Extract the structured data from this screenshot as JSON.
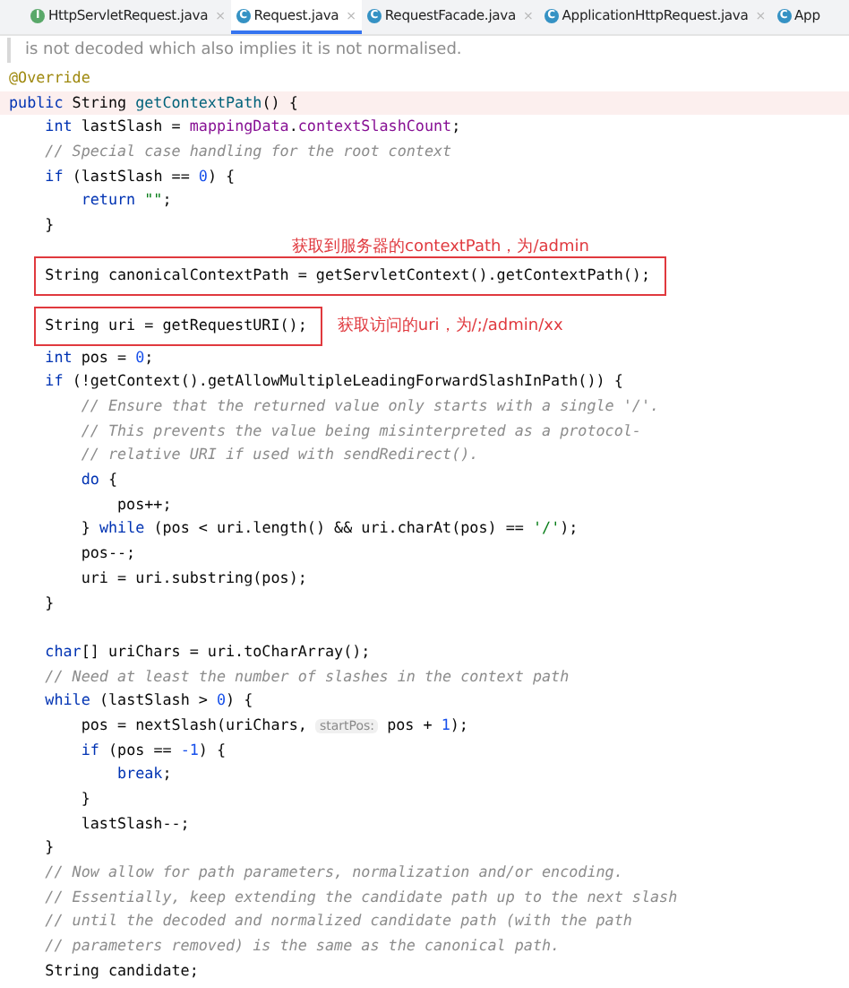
{
  "tabs": [
    {
      "badge": "I",
      "color": "#59a869",
      "label": "HttpServletRequest.java",
      "close": "×",
      "selected": false
    },
    {
      "badge": "C",
      "color": "#3592c4",
      "label": "Request.java",
      "close": "×",
      "selected": true
    },
    {
      "badge": "C",
      "color": "#3592c4",
      "label": "RequestFacade.java",
      "close": "×",
      "selected": false
    },
    {
      "badge": "C",
      "color": "#3592c4",
      "label": "ApplicationHttpRequest.java",
      "close": "×",
      "selected": false
    },
    {
      "badge": "C",
      "color": "#3592c4",
      "label": "App",
      "selected": false
    }
  ],
  "doc_comment": "is not decoded which also implies it is not normalised.",
  "code_lines": [
    {
      "kind": "code",
      "tokens": [
        {
          "kind": "annotation",
          "text": "@Override"
        }
      ]
    },
    {
      "kind": "current",
      "tokens": [
        {
          "kind": "kw",
          "text": "public "
        },
        {
          "kind": "plain",
          "text": "String "
        },
        {
          "kind": "decl",
          "text": "getContextPath"
        },
        {
          "kind": "plain",
          "text": "() {"
        }
      ]
    },
    {
      "kind": "code",
      "tokens": [
        {
          "kind": "kw",
          "text": "    int "
        },
        {
          "kind": "plain",
          "text": "lastSlash = "
        },
        {
          "kind": "field",
          "text": "mappingData"
        },
        {
          "kind": "plain",
          "text": "."
        },
        {
          "kind": "field",
          "text": "contextSlashCount"
        },
        {
          "kind": "plain",
          "text": ";"
        }
      ]
    },
    {
      "kind": "code",
      "tokens": [
        {
          "kind": "comment",
          "text": "    // Special case handling for the root context"
        }
      ]
    },
    {
      "kind": "code",
      "tokens": [
        {
          "kind": "kw",
          "text": "    if "
        },
        {
          "kind": "plain",
          "text": "(lastSlash == "
        },
        {
          "kind": "num",
          "text": "0"
        },
        {
          "kind": "plain",
          "text": ") {"
        }
      ]
    },
    {
      "kind": "code",
      "tokens": [
        {
          "kind": "kw",
          "text": "        return "
        },
        {
          "kind": "str",
          "text": "\"\""
        },
        {
          "kind": "plain",
          "text": ";"
        }
      ]
    },
    {
      "kind": "code",
      "tokens": [
        {
          "kind": "plain",
          "text": "    }"
        }
      ]
    },
    {
      "kind": "note",
      "note": "获取到服务器的contextPath，为/admin"
    },
    {
      "kind": "boxed",
      "tokens": [
        {
          "kind": "plain",
          "text": "    String canonicalContextPath = getServletContext().getContextPath();"
        }
      ]
    },
    {
      "kind": "boxed",
      "note": "获取访问的uri，为/;/admin/xx",
      "tokens": [
        {
          "kind": "plain",
          "text": "    String uri = getRequestURI();"
        }
      ]
    },
    {
      "kind": "code",
      "tokens": [
        {
          "kind": "kw",
          "text": "    int "
        },
        {
          "kind": "plain",
          "text": "pos = "
        },
        {
          "kind": "num",
          "text": "0"
        },
        {
          "kind": "plain",
          "text": ";"
        }
      ]
    },
    {
      "kind": "code",
      "tokens": [
        {
          "kind": "kw",
          "text": "    if "
        },
        {
          "kind": "plain",
          "text": "(!getContext().getAllowMultipleLeadingForwardSlashInPath()) {"
        }
      ]
    },
    {
      "kind": "code",
      "tokens": [
        {
          "kind": "comment",
          "text": "        // Ensure that the returned value only starts with a single '/'."
        }
      ]
    },
    {
      "kind": "code",
      "tokens": [
        {
          "kind": "comment",
          "text": "        // This prevents the value being misinterpreted as a protocol-"
        }
      ]
    },
    {
      "kind": "code",
      "tokens": [
        {
          "kind": "comment",
          "text": "        // relative URI if used with sendRedirect()."
        }
      ]
    },
    {
      "kind": "code",
      "tokens": [
        {
          "kind": "kw",
          "text": "        do "
        },
        {
          "kind": "plain",
          "text": "{"
        }
      ]
    },
    {
      "kind": "code",
      "tokens": [
        {
          "kind": "plain",
          "text": "            pos++;"
        }
      ]
    },
    {
      "kind": "code",
      "tokens": [
        {
          "kind": "plain",
          "text": "        } "
        },
        {
          "kind": "kw",
          "text": "while "
        },
        {
          "kind": "plain",
          "text": "(pos < uri.length() && uri.charAt(pos) == "
        },
        {
          "kind": "str",
          "text": "'/'"
        },
        {
          "kind": "plain",
          "text": ");"
        }
      ]
    },
    {
      "kind": "code",
      "tokens": [
        {
          "kind": "plain",
          "text": "        pos--;"
        }
      ]
    },
    {
      "kind": "code",
      "tokens": [
        {
          "kind": "plain",
          "text": "        uri = uri.substring(pos);"
        }
      ]
    },
    {
      "kind": "code",
      "tokens": [
        {
          "kind": "plain",
          "text": "    }"
        }
      ]
    },
    {
      "kind": "blank"
    },
    {
      "kind": "code",
      "tokens": [
        {
          "kind": "kw",
          "text": "    char"
        },
        {
          "kind": "plain",
          "text": "[] uriChars = uri.toCharArray();"
        }
      ]
    },
    {
      "kind": "code",
      "tokens": [
        {
          "kind": "comment",
          "text": "    // Need at least the number of slashes in the context path"
        }
      ]
    },
    {
      "kind": "code",
      "tokens": [
        {
          "kind": "kw",
          "text": "    while "
        },
        {
          "kind": "plain",
          "text": "(lastSlash > "
        },
        {
          "kind": "num",
          "text": "0"
        },
        {
          "kind": "plain",
          "text": ") {"
        }
      ]
    },
    {
      "kind": "code",
      "tokens": [
        {
          "kind": "plain",
          "text": "        pos = nextSlash(uriChars, "
        },
        {
          "kind": "hint",
          "text": "startPos:"
        },
        {
          "kind": "plain",
          "text": " pos + "
        },
        {
          "kind": "num",
          "text": "1"
        },
        {
          "kind": "plain",
          "text": ");"
        }
      ]
    },
    {
      "kind": "code",
      "tokens": [
        {
          "kind": "kw",
          "text": "        if "
        },
        {
          "kind": "plain",
          "text": "(pos == "
        },
        {
          "kind": "num",
          "text": "-1"
        },
        {
          "kind": "plain",
          "text": ") {"
        }
      ]
    },
    {
      "kind": "code",
      "tokens": [
        {
          "kind": "kw",
          "text": "            break"
        },
        {
          "kind": "plain",
          "text": ";"
        }
      ]
    },
    {
      "kind": "code",
      "tokens": [
        {
          "kind": "plain",
          "text": "        }"
        }
      ]
    },
    {
      "kind": "code",
      "tokens": [
        {
          "kind": "plain",
          "text": "        lastSlash--;"
        }
      ]
    },
    {
      "kind": "code",
      "tokens": [
        {
          "kind": "plain",
          "text": "    }"
        }
      ]
    },
    {
      "kind": "code",
      "tokens": [
        {
          "kind": "comment",
          "text": "    // Now allow for path parameters, normalization and/or encoding."
        }
      ]
    },
    {
      "kind": "code",
      "tokens": [
        {
          "kind": "comment",
          "text": "    // Essentially, keep extending the candidate path up to the next slash"
        }
      ]
    },
    {
      "kind": "code",
      "tokens": [
        {
          "kind": "comment",
          "text": "    // until the decoded and normalized candidate path (with the path"
        }
      ]
    },
    {
      "kind": "code",
      "tokens": [
        {
          "kind": "comment",
          "text": "    // parameters removed) is the same as the canonical path."
        }
      ]
    },
    {
      "kind": "code",
      "tokens": [
        {
          "kind": "plain",
          "text": "    String candidate;"
        }
      ]
    }
  ]
}
